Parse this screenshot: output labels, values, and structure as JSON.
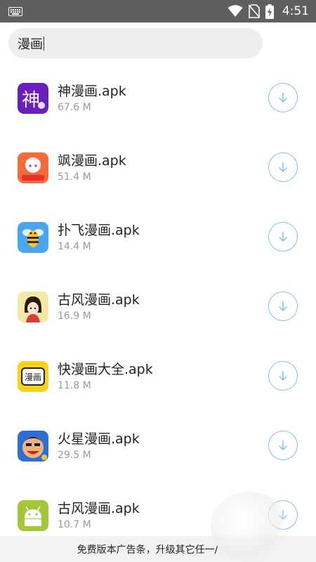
{
  "status_bar": {
    "time": "4:51",
    "icons": [
      "keyboard-icon",
      "wifi-icon",
      "no-sim-icon",
      "battery-charging-icon"
    ]
  },
  "search": {
    "value": "漫画"
  },
  "files": [
    {
      "name": "神漫画.apk",
      "size": "67.6 M",
      "icon": "shen-manhua-app-icon",
      "icon_color": "#6a1fb8"
    },
    {
      "name": "飒漫画.apk",
      "size": "51.4 M",
      "icon": "sa-manhua-app-icon",
      "icon_color": "#f46b3b"
    },
    {
      "name": "扑飞漫画.apk",
      "size": "14.4 M",
      "icon": "pufei-manhua-bee-icon",
      "icon_color": "#4aa7ef"
    },
    {
      "name": "古风漫画.apk",
      "size": "16.9 M",
      "icon": "gufeng-manhua-girl-icon",
      "icon_color": "#f6e6a8"
    },
    {
      "name": "快漫画大全.apk",
      "size": "11.8 M",
      "icon": "kuai-manhua-app-icon",
      "icon_color": "#ffd21a",
      "icon_text": "漫画"
    },
    {
      "name": "火星漫画.apk",
      "size": "29.5 M",
      "icon": "huoxing-manhua-app-icon",
      "icon_color": "#2b6fd6"
    },
    {
      "name": "古风漫画.apk",
      "size": "10.7 M",
      "icon": "android-default-icon",
      "icon_color": "#a4c639"
    }
  ],
  "ad_banner": {
    "text": "免费版本广告条，升级其它任一/"
  },
  "colors": {
    "accent": "#7cc4ea",
    "status_bar": "#5f5f5f"
  }
}
